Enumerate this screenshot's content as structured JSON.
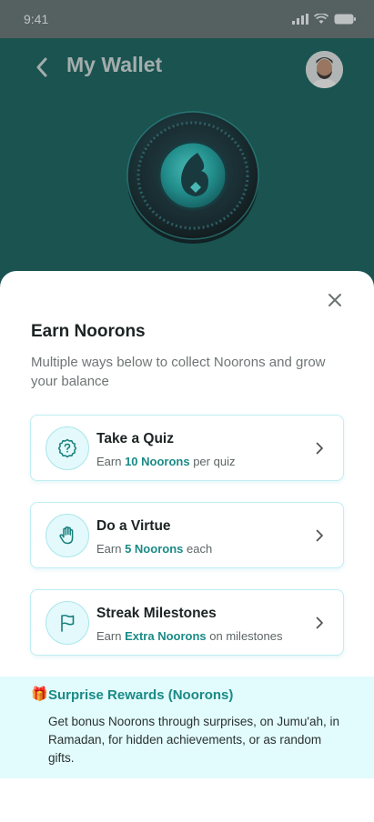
{
  "status_bar": {
    "time": "9:41"
  },
  "header": {
    "title": "My Wallet",
    "back_icon": "chevron-left-icon",
    "avatar": "user-avatar"
  },
  "coin": {
    "icon": "noorons-coin-icon"
  },
  "sheet": {
    "title": "Earn Noorons",
    "subtitle": "Multiple ways below to collect Noorons and grow your balance",
    "close_icon": "close-icon",
    "options": [
      {
        "title": "Take a Quiz",
        "desc_prefix": "Earn ",
        "desc_highlight": "10 Noorons",
        "desc_suffix": " per quiz",
        "icon": "quiz-icon"
      },
      {
        "title": "Do a Virtue",
        "desc_prefix": "Earn ",
        "desc_highlight": "5 Noorons",
        "desc_suffix": " each",
        "icon": "hand-icon"
      },
      {
        "title": "Streak Milestones",
        "desc_prefix": "Earn ",
        "desc_highlight": "Extra Noorons",
        "desc_suffix": " on milestones",
        "icon": "flag-icon"
      }
    ],
    "surprise": {
      "icon": "🎁",
      "title": "Surprise Rewards (Noorons)",
      "text": "Get bonus Noorons through surprises, on Jumu'ah, in Ramadan, for hidden achievements, or as random gifts."
    }
  },
  "colors": {
    "header": "#0f5b57",
    "accent": "#1a8a86",
    "card_border": "#bfeef3",
    "surprise_bg": "#e2fbfc"
  }
}
